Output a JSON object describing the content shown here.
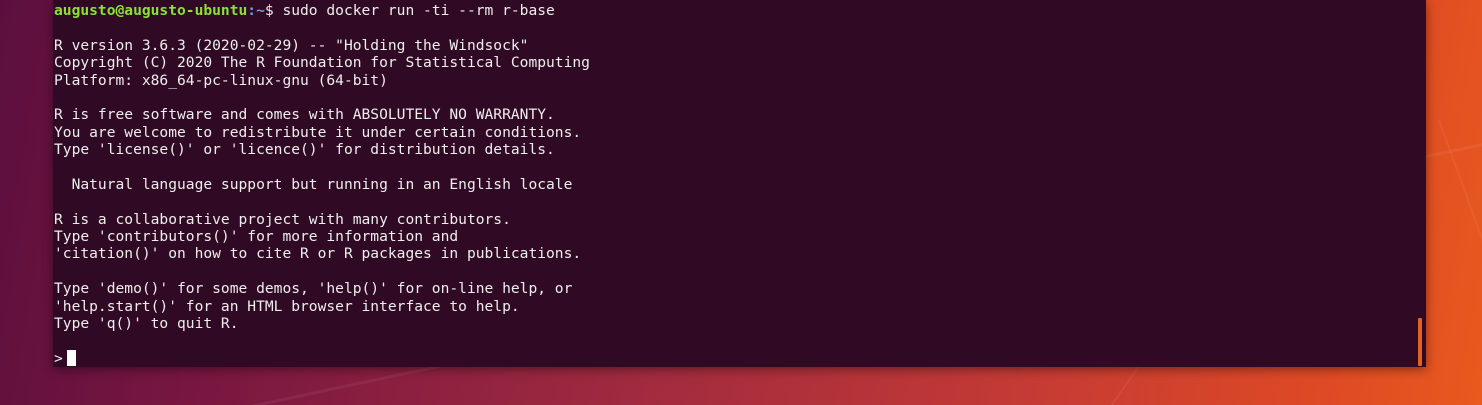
{
  "terminal": {
    "prompt": {
      "user_host": "augusto@augusto-ubuntu",
      "path": ":~",
      "symbol": "$ ",
      "command": "sudo docker run -ti --rm r-base"
    },
    "output": [
      "",
      "R version 3.6.3 (2020-02-29) -- \"Holding the Windsock\"",
      "Copyright (C) 2020 The R Foundation for Statistical Computing",
      "Platform: x86_64-pc-linux-gnu (64-bit)",
      "",
      "R is free software and comes with ABSOLUTELY NO WARRANTY.",
      "You are welcome to redistribute it under certain conditions.",
      "Type 'license()' or 'licence()' for distribution details.",
      "",
      "  Natural language support but running in an English locale",
      "",
      "R is a collaborative project with many contributors.",
      "Type 'contributors()' for more information and",
      "'citation()' on how to cite R or R packages in publications.",
      "",
      "Type 'demo()' for some demos, 'help()' for on-line help, or",
      "'help.start()' for an HTML browser interface to help.",
      "Type 'q()' to quit R.",
      ""
    ],
    "r_prompt": ">"
  },
  "colors": {
    "terminal_bg": "#300a24",
    "text": "#eeeeec",
    "user": "#8ae234",
    "path": "#729fcf",
    "scroll_accent": "#e0641f"
  }
}
